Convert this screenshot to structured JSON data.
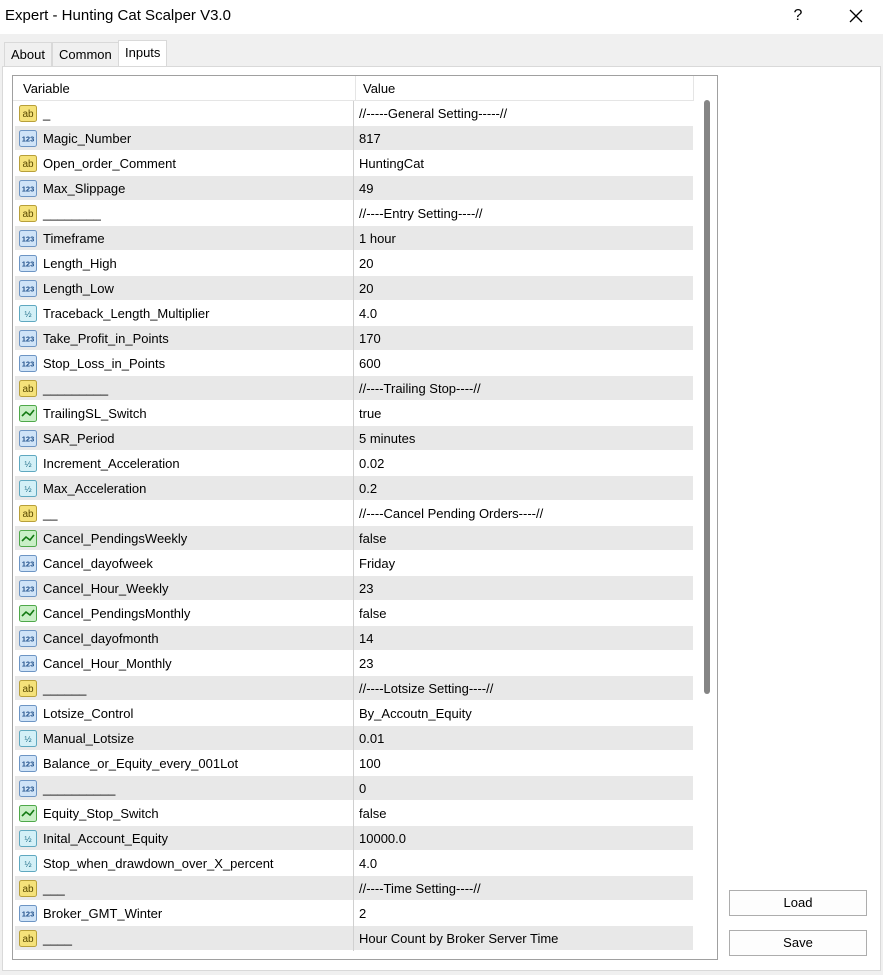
{
  "window": {
    "title": "Expert - Hunting Cat Scalper V3.0",
    "help_label": "?"
  },
  "tabs": [
    {
      "label": "About"
    },
    {
      "label": "Common"
    },
    {
      "label": "Inputs"
    }
  ],
  "table": {
    "col_variable": "Variable",
    "col_value": "Value"
  },
  "rows": [
    {
      "icon": "string-icon",
      "name": "_",
      "value": "//-----General Setting-----//"
    },
    {
      "icon": "integer-icon",
      "name": "Magic_Number",
      "value": "817"
    },
    {
      "icon": "string-icon",
      "name": "Open_order_Comment",
      "value": "HuntingCat"
    },
    {
      "icon": "integer-icon",
      "name": "Max_Slippage",
      "value": "49"
    },
    {
      "icon": "string-icon",
      "name": "________",
      "value": "//----Entry Setting----//"
    },
    {
      "icon": "integer-icon",
      "name": "Timeframe",
      "value": "1 hour"
    },
    {
      "icon": "integer-icon",
      "name": "Length_High",
      "value": "20"
    },
    {
      "icon": "integer-icon",
      "name": "Length_Low",
      "value": "20"
    },
    {
      "icon": "double-icon",
      "name": "Traceback_Length_Multiplier",
      "value": "4.0"
    },
    {
      "icon": "integer-icon",
      "name": "Take_Profit_in_Points",
      "value": "170"
    },
    {
      "icon": "integer-icon",
      "name": "Stop_Loss_in_Points",
      "value": "600"
    },
    {
      "icon": "string-icon",
      "name": "_________",
      "value": "//----Trailing Stop----//"
    },
    {
      "icon": "bool-icon",
      "name": "TrailingSL_Switch",
      "value": "true"
    },
    {
      "icon": "integer-icon",
      "name": "SAR_Period",
      "value": "5 minutes"
    },
    {
      "icon": "double-icon",
      "name": "Increment_Acceleration",
      "value": "0.02"
    },
    {
      "icon": "double-icon",
      "name": "Max_Acceleration",
      "value": "0.2"
    },
    {
      "icon": "string-icon",
      "name": "__",
      "value": "//----Cancel Pending Orders----//"
    },
    {
      "icon": "bool-icon",
      "name": "Cancel_PendingsWeekly",
      "value": "false"
    },
    {
      "icon": "integer-icon",
      "name": "Cancel_dayofweek",
      "value": "Friday"
    },
    {
      "icon": "integer-icon",
      "name": "Cancel_Hour_Weekly",
      "value": "23"
    },
    {
      "icon": "bool-icon",
      "name": "Cancel_PendingsMonthly",
      "value": "false"
    },
    {
      "icon": "integer-icon",
      "name": "Cancel_dayofmonth",
      "value": "14"
    },
    {
      "icon": "integer-icon",
      "name": "Cancel_Hour_Monthly",
      "value": "23"
    },
    {
      "icon": "string-icon",
      "name": "______",
      "value": "//----Lotsize Setting----//"
    },
    {
      "icon": "integer-icon",
      "name": "Lotsize_Control",
      "value": "By_Accoutn_Equity"
    },
    {
      "icon": "double-icon",
      "name": "Manual_Lotsize",
      "value": "0.01"
    },
    {
      "icon": "integer-icon",
      "name": "Balance_or_Equity_every_001Lot",
      "value": "100"
    },
    {
      "icon": "integer-icon",
      "name": "__________",
      "value": "0"
    },
    {
      "icon": "bool-icon",
      "name": "Equity_Stop_Switch",
      "value": "false"
    },
    {
      "icon": "double-icon",
      "name": "Inital_Account_Equity",
      "value": "10000.0"
    },
    {
      "icon": "double-icon",
      "name": "Stop_when_drawdown_over_X_percent",
      "value": "4.0"
    },
    {
      "icon": "string-icon",
      "name": "___",
      "value": "//----Time Setting----//"
    },
    {
      "icon": "integer-icon",
      "name": "Broker_GMT_Winter",
      "value": "2"
    },
    {
      "icon": "string-icon",
      "name": "____",
      "value": "Hour Count by Broker Server Time"
    }
  ],
  "buttons": {
    "load": "Load",
    "save": "Save"
  }
}
